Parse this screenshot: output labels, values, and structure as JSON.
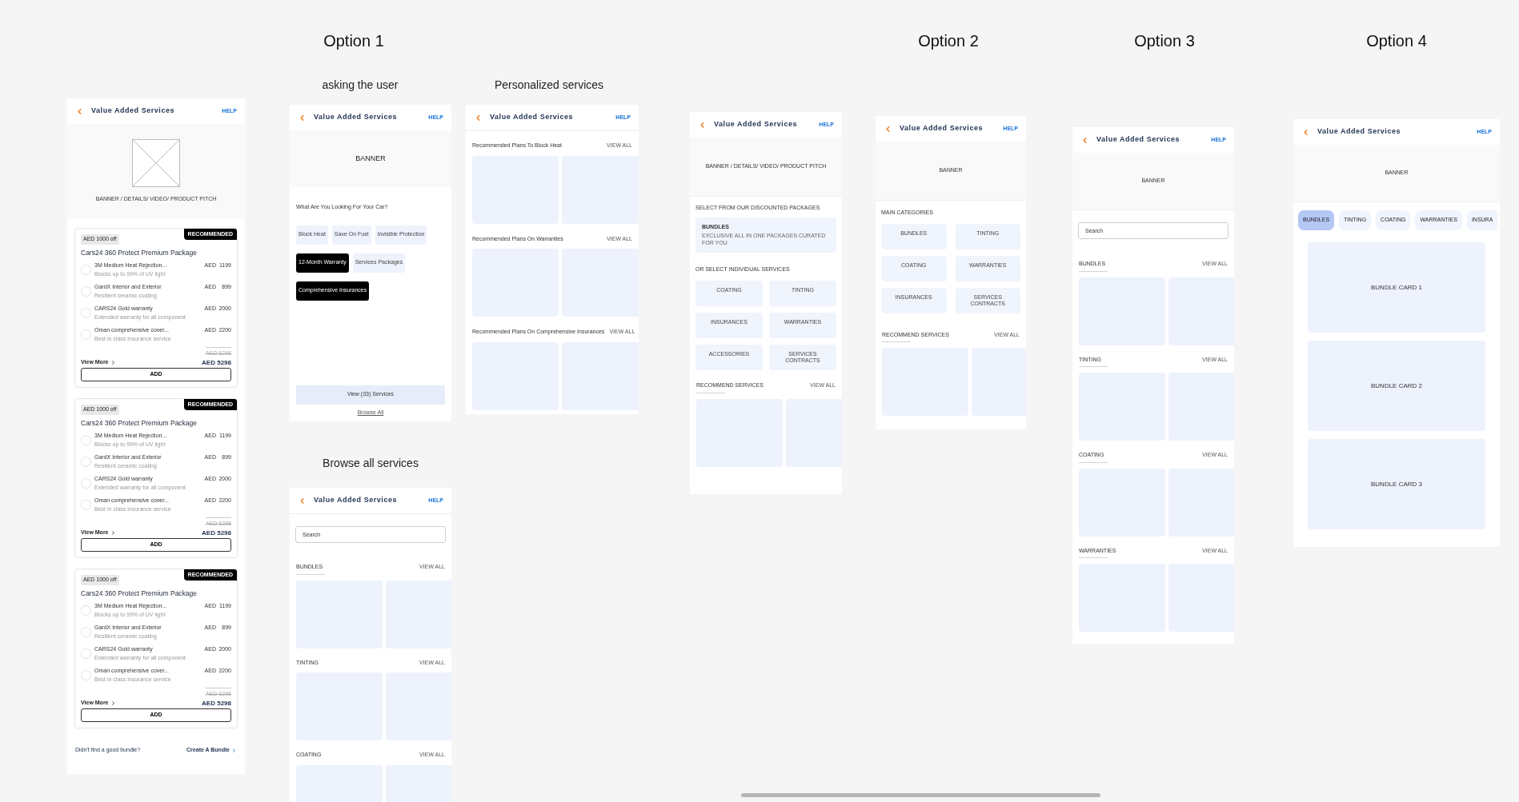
{
  "options": [
    {
      "label": "Option 1"
    },
    {
      "label": "Option 2"
    },
    {
      "label": "Option 3"
    },
    {
      "label": "Option 4"
    }
  ],
  "current": {
    "title": "Value Added Services",
    "help": "HELP",
    "banner_text": "BANNER / DETAILS/ VIDEO/ PRODUCT PITCH",
    "packages": [
      {
        "discount": "AED 1000 off",
        "badge": "RECOMMENDED",
        "name": "Cars24 360 Protect Premium Package",
        "items": [
          {
            "name": "3M Medium Heat Rejection...",
            "desc": "Blocks up to 99% of UV light",
            "currency": "AED",
            "price": "1199"
          },
          {
            "name": "GardX Interior and Exterior",
            "desc": "Resilient ceramic coating",
            "currency": "AED",
            "price": "899"
          },
          {
            "name": "CARS24 Gold warranty",
            "desc": "Extended warranty for all component",
            "currency": "AED",
            "price": "2000"
          },
          {
            "name": "Oman comprehensive cover...",
            "desc": "Best in class insurance service",
            "currency": "AED",
            "price": "2200"
          }
        ],
        "old_price": "AED 6298",
        "view_more": "View More",
        "total": "AED 5298",
        "add": "ADD"
      },
      {
        "discount": "AED 1000 off",
        "badge": "RECOMMENDED",
        "name": "Cars24 360 Protect Premium Package",
        "items": [
          {
            "name": "3M Medium Heat Rejection...",
            "desc": "Blocks up to 99% of UV light",
            "currency": "AED",
            "price": "1199"
          },
          {
            "name": "GardX Interior and Exterior",
            "desc": "Resilient ceramic coating",
            "currency": "AED",
            "price": "899"
          },
          {
            "name": "CARS24 Gold warranty",
            "desc": "Extended warranty for all component",
            "currency": "AED",
            "price": "2000"
          },
          {
            "name": "Oman comprehensive cover...",
            "desc": "Best in class insurance service",
            "currency": "AED",
            "price": "2200"
          }
        ],
        "old_price": "AED 6298",
        "view_more": "View More",
        "total": "AED 5298",
        "add": "ADD"
      },
      {
        "discount": "AED 1000 off",
        "badge": "RECOMMENDED",
        "name": "Cars24 360 Protect Premium Package",
        "items": [
          {
            "name": "3M Medium Heat Rejection...",
            "desc": "Blocks up to 99% of UV light",
            "currency": "AED",
            "price": "1199"
          },
          {
            "name": "GardX Interior and Exterior",
            "desc": "Resilient ceramic coating",
            "currency": "AED",
            "price": "899"
          },
          {
            "name": "CARS24 Gold warranty",
            "desc": "Extended warranty for all component",
            "currency": "AED",
            "price": "2000"
          },
          {
            "name": "Oman comprehensive cover...",
            "desc": "Best in class insurance service",
            "currency": "AED",
            "price": "2200"
          }
        ],
        "old_price": "AED 6298",
        "view_more": "View More",
        "total": "AED 5298",
        "add": "ADD"
      }
    ],
    "footer_question": "Didn't find a good bundle?",
    "footer_link": "Create A Bundle"
  },
  "option_1": {
    "asking": {
      "caption": "asking the user",
      "title": "Value Added Services",
      "help": "HELP",
      "banner": "BANNER",
      "question": "What Are You Looking For Your Car?",
      "chips": [
        {
          "label": "Block Heat",
          "selected": false
        },
        {
          "label": "Save On Fuel",
          "selected": false
        },
        {
          "label": "Invisible Protection",
          "selected": false
        },
        {
          "label": "12-Month Warranty",
          "selected": true
        },
        {
          "label": "Services Packages",
          "selected": false
        },
        {
          "label": "Comprehensive Insurances",
          "selected": true
        }
      ],
      "cta": "View (33) Services",
      "link": "Browse All"
    },
    "personalized": {
      "caption": "Personalized services",
      "title": "Value Added Services",
      "help": "HELP",
      "sections": [
        {
          "title": "Recommended Plans To Block Heat",
          "view_all": "VIEW ALL"
        },
        {
          "title": "Recommended Plans On Warranties",
          "view_all": "VIEW ALL"
        },
        {
          "title": "Recommended Plans On Comprehensive Insurances",
          "view_all": "VIEW ALL"
        }
      ]
    },
    "browse": {
      "caption": "Browse all services",
      "title": "Value Added Services",
      "help": "HELP",
      "search_placeholder": "Search",
      "sections": [
        {
          "title": "BUNDLES",
          "view_all": "VIEW ALL"
        },
        {
          "title": "TINTING",
          "view_all": "VIEW ALL"
        },
        {
          "title": "COATING",
          "view_all": "VIEW ALL"
        }
      ]
    }
  },
  "option_2": {
    "discounted": {
      "title": "Value Added Services",
      "help": "HELP",
      "banner": "BANNER / DETAILS/ VIDEO/ PRODUCT PITCH",
      "packages_label": "SELECT FROM OUR DISCOUNTED PACKAGES",
      "bundle_title": "BUNDLES",
      "bundle_desc": "EXCLUSIVE ALL IN ONE PACKAGES CURATED FOR YOU",
      "individual_label": "OR SELECT INDIVIDUAL SERVICES",
      "tiles": [
        "COATING",
        "TINTING",
        "INSURANCES",
        "WARRANTIES",
        "ACCESSORIES",
        "SERVICES CONTRACTS"
      ],
      "recommend_title": "RECOMMEND SERVICES",
      "view_all": "VIEW ALL"
    },
    "categories": {
      "title": "Value Added Services",
      "help": "HELP",
      "banner": "BANNER",
      "categories_label": "MAIN CATEGORIES",
      "tiles": [
        "BUNDLES",
        "TINTING",
        "COATING",
        "WARRANTIES",
        "INSURANCES",
        "SERVICES CONTRACTS"
      ],
      "recommend_title": "RECOMMEND SERVICES",
      "view_all": "VIEW ALL"
    }
  },
  "option_3": {
    "title": "Value Added Services",
    "help": "HELP",
    "banner": "BANNER",
    "search_placeholder": "Search",
    "sections": [
      {
        "title": "BUNDLES",
        "view_all": "VIEW ALL"
      },
      {
        "title": "TINTING",
        "view_all": "VIEW ALL"
      },
      {
        "title": "COATING",
        "view_all": "VIEW ALL"
      },
      {
        "title": "WARRANTIES",
        "view_all": "VIEW ALL"
      }
    ]
  },
  "option_4": {
    "title": "Value Added Services",
    "help": "HELP",
    "banner": "BANNER",
    "tabs": [
      {
        "label": "BUNDLES",
        "selected": true
      },
      {
        "label": "TINTING",
        "selected": false
      },
      {
        "label": "COATING",
        "selected": false
      },
      {
        "label": "WARRANTIES",
        "selected": false
      },
      {
        "label": "INSURA",
        "selected": false
      }
    ],
    "cards": [
      "BUNDLE CARD 1",
      "BUNDLE CARD 2",
      "BUNDLE CARD 3"
    ]
  }
}
